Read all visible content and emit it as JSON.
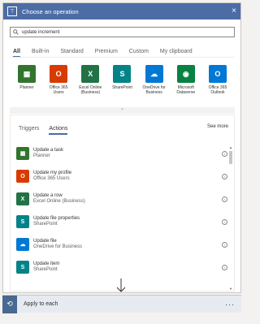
{
  "header": {
    "title": "Choose an operation",
    "close": "×"
  },
  "search": {
    "value": "update increment"
  },
  "category_tabs": [
    {
      "label": "All",
      "active": true
    },
    {
      "label": "Built-in",
      "active": false
    },
    {
      "label": "Standard",
      "active": false
    },
    {
      "label": "Premium",
      "active": false
    },
    {
      "label": "Custom",
      "active": false
    },
    {
      "label": "My clipboard",
      "active": false
    }
  ],
  "connectors": [
    {
      "label": "Planner",
      "color": "#31752f",
      "icon": "planner-icon",
      "glyph": "▦"
    },
    {
      "label": "Office 365 Users",
      "color": "#d83b01",
      "icon": "office365-icon",
      "glyph": "O"
    },
    {
      "label": "Excel Online (Business)",
      "color": "#217346",
      "icon": "excel-icon",
      "glyph": "X"
    },
    {
      "label": "SharePoint",
      "color": "#038387",
      "icon": "sharepoint-icon",
      "glyph": "S"
    },
    {
      "label": "OneDrive for Business",
      "color": "#0078d4",
      "icon": "onedrive-icon",
      "glyph": "☁"
    },
    {
      "label": "Microsoft Dataverse",
      "color": "#088142",
      "icon": "dataverse-icon",
      "glyph": "◉"
    },
    {
      "label": "Office 365 Outlook",
      "color": "#0078d4",
      "icon": "outlook-icon",
      "glyph": "O"
    }
  ],
  "action_tabs": [
    {
      "label": "Triggers",
      "active": false
    },
    {
      "label": "Actions",
      "active": true
    }
  ],
  "see_more": "See more",
  "actions": [
    {
      "title": "Update a task",
      "connector": "Planner",
      "color": "#31752f",
      "glyph": "▦",
      "icon": "planner-icon"
    },
    {
      "title": "Update my profile",
      "connector": "Office 365 Users",
      "color": "#d83b01",
      "glyph": "O",
      "icon": "office365-icon"
    },
    {
      "title": "Update a row",
      "connector": "Excel Online (Business)",
      "color": "#217346",
      "glyph": "X",
      "icon": "excel-icon"
    },
    {
      "title": "Update file properties",
      "connector": "SharePoint",
      "color": "#038387",
      "glyph": "S",
      "icon": "sharepoint-icon"
    },
    {
      "title": "Update file",
      "connector": "OneDrive for Business",
      "color": "#0078d4",
      "glyph": "☁",
      "icon": "onedrive-icon"
    },
    {
      "title": "Update item",
      "connector": "SharePoint",
      "color": "#038387",
      "glyph": "S",
      "icon": "sharepoint-icon"
    }
  ],
  "apply": {
    "label": "Apply to each",
    "more": "···"
  }
}
